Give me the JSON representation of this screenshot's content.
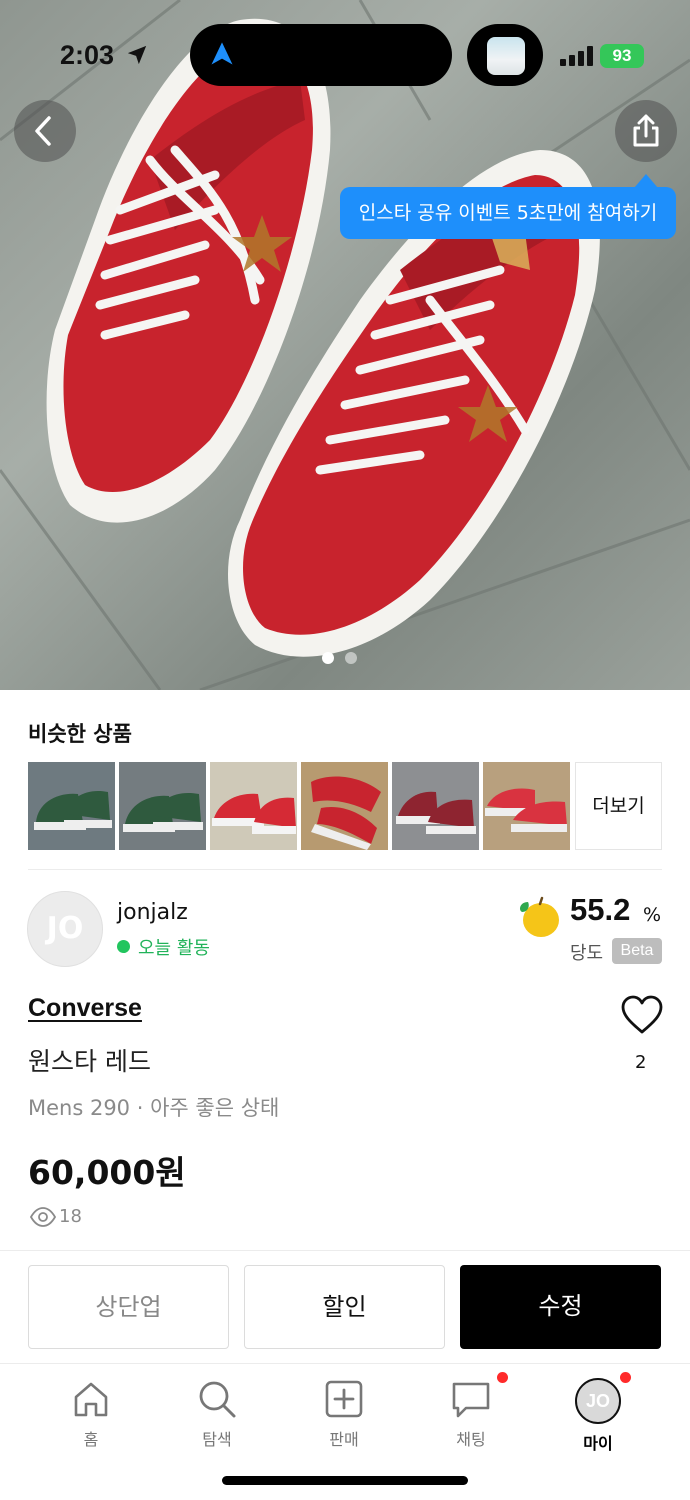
{
  "status_bar": {
    "time": "2:03",
    "battery": "93"
  },
  "tooltip": {
    "text": "인스타 공유 이벤트 5초만에 참여하기"
  },
  "similar": {
    "title": "비슷한 상품",
    "items": [
      {
        "color": "#2f5a3e"
      },
      {
        "color": "#2f5a3e"
      },
      {
        "color": "#d52a35"
      },
      {
        "color": "#c8242f"
      },
      {
        "color": "#8e2430"
      },
      {
        "color": "#d93340"
      }
    ],
    "more_label": "더보기"
  },
  "seller": {
    "initials": "JO",
    "name": "jonjalz",
    "activity": "오늘 활동",
    "sweetness_value": "55.2",
    "sweetness_unit": "%",
    "sweetness_label": "당도",
    "beta": "Beta"
  },
  "product": {
    "brand": "Converse",
    "name": "원스타 레드",
    "meta": "Mens 290 · 아주 좋은 상태",
    "price": "60,000원",
    "views": "18",
    "likes": "2"
  },
  "actions": {
    "bump": "상단업",
    "discount": "할인",
    "edit": "수정"
  },
  "tabs": [
    {
      "label": "홈",
      "icon": "home-icon"
    },
    {
      "label": "탐색",
      "icon": "search-icon"
    },
    {
      "label": "판매",
      "icon": "plus-square-icon"
    },
    {
      "label": "채팅",
      "icon": "chat-icon"
    },
    {
      "label": "마이",
      "icon": "avatar-icon",
      "initials": "JO"
    }
  ],
  "colors": {
    "accent_blue": "#1e8ffb",
    "active_green": "#22c55e",
    "badge_red": "#ff2a2a",
    "shoe_red": "#c8232d"
  }
}
